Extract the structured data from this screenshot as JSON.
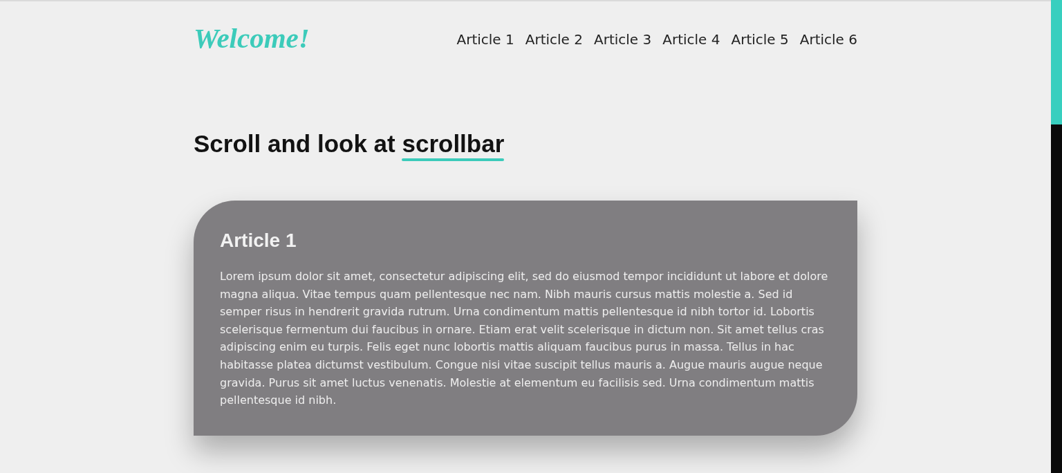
{
  "logo": {
    "text": "Welcome!"
  },
  "nav": {
    "links": [
      {
        "label": "Article 1"
      },
      {
        "label": "Article 2"
      },
      {
        "label": "Article 3"
      },
      {
        "label": "Article 4"
      },
      {
        "label": "Article 5"
      },
      {
        "label": "Article 6"
      }
    ]
  },
  "heading": {
    "parts": [
      {
        "text": "Scroll and look at",
        "underlined": false
      },
      {
        "text": "scrollbar",
        "underlined": true
      }
    ]
  },
  "articles": [
    {
      "title": "Article 1",
      "body": "Lorem ipsum dolor sit amet, consectetur adipiscing elit, sed do eiusmod tempor incididunt ut labore et dolore magna aliqua. Vitae tempus quam pellentesque nec nam. Nibh mauris cursus mattis molestie a. Sed id semper risus in hendrerit gravida rutrum. Urna condimentum mattis pellentesque id nibh tortor id. Lobortis scelerisque fermentum dui faucibus in ornare. Etiam erat velit scelerisque in dictum non. Sit amet tellus cras adipiscing enim eu turpis. Felis eget nunc lobortis mattis aliquam faucibus purus in massa. Tellus in hac habitasse platea dictumst vestibulum. Congue nisi vitae suscipit tellus mauris a. Augue mauris augue neque gravida. Purus sit amet luctus venenatis. Molestie at elementum eu facilisis sed. Urna condimentum mattis pellentesque id nibh."
    }
  ]
}
